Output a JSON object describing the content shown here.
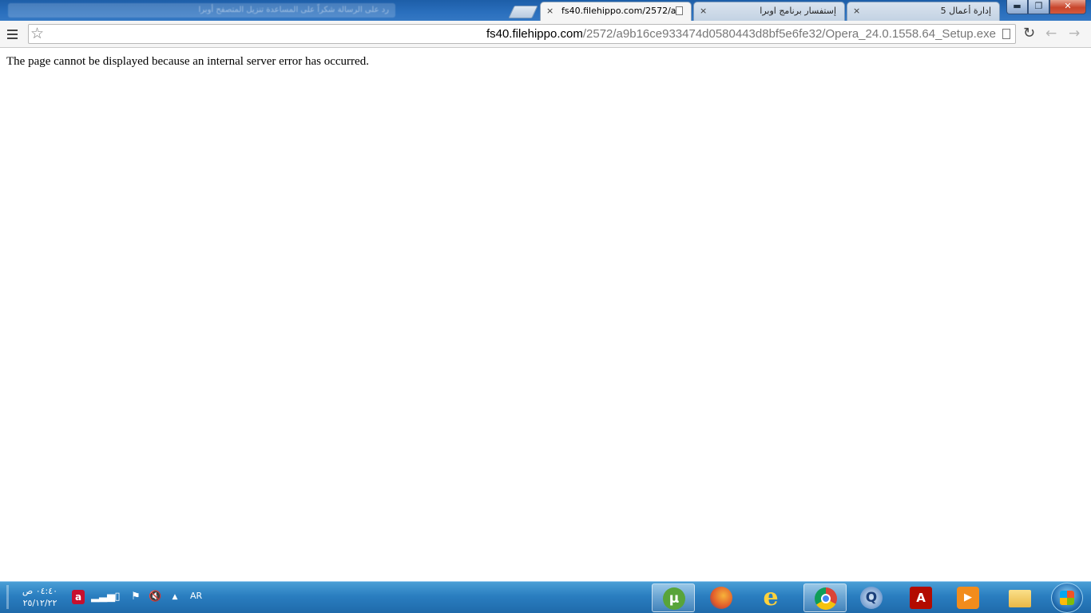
{
  "window": {
    "background_title": "رد على الرسالة  شكراً على المساعدة  تنزيل المتصفح أوبرا",
    "controls": {
      "minimize": "▬",
      "maximize": "❐",
      "close": "✕"
    }
  },
  "tabs": [
    {
      "title": "fs40.filehippo.com/2572/a",
      "active": true
    },
    {
      "title": "إستفسار برنامج اوبرا",
      "active": false
    },
    {
      "title": "إدارة أعمال 5",
      "active": false
    }
  ],
  "tab_close_glyph": "×",
  "toolbar": {
    "url_host": "fs40.filehippo.com",
    "url_path": "/2572/a9b16ce933474d0580443d8bf5e6fe32/Opera_24.0.1558.64_Setup.exe",
    "star_glyph": "☆",
    "reload_glyph": "↻",
    "back_glyph": "←",
    "forward_glyph": "→"
  },
  "page": {
    "error_message": "The page cannot be displayed because an internal server error has occurred."
  },
  "taskbar": {
    "time": "٠٤:٤٠ ص",
    "date": "٢٥/١٢/٢٢",
    "language": "AR",
    "tray_glyphs": {
      "avira": "a",
      "signal": "▂▃▅",
      "battery": "▯",
      "flag": "⚑",
      "volume": "🔇",
      "arrow": "▲"
    },
    "apps": {
      "utorrent": "µ",
      "ie": "e",
      "quicktime": "Q",
      "acrobat": "A",
      "media": "▶"
    }
  },
  "colors": {
    "taskbar": "#2a7ec0",
    "titlebar": "#2a6fbd",
    "close_button": "#c8452c"
  }
}
